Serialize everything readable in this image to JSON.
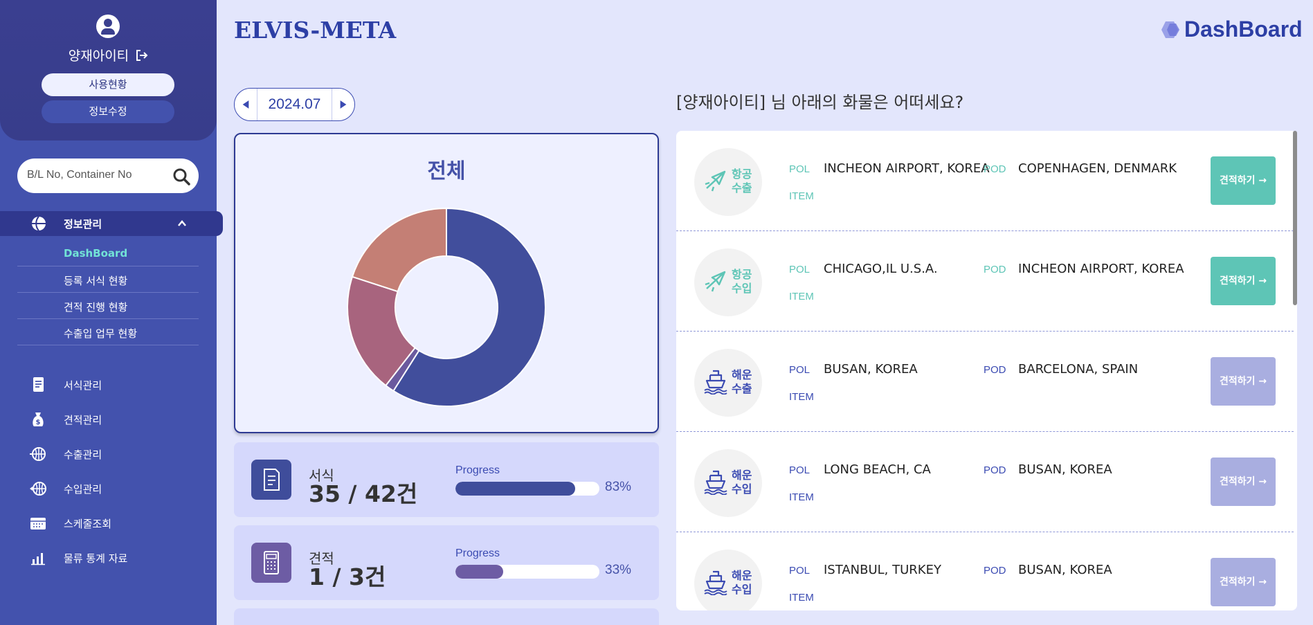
{
  "sidebar": {
    "user_name": "양재아이티",
    "usage_label": "사용현황",
    "edit_label": "정보수정",
    "search_placeholder": "B/L No, Container No",
    "open_menu": {
      "label": "정보관리",
      "icon": "globe-icon"
    },
    "submenu": [
      {
        "label": "DashBoard",
        "active": true
      },
      {
        "label": "등록 서식 현황"
      },
      {
        "label": "견적 진행 현황"
      },
      {
        "label": "수출입 업무 현황"
      }
    ],
    "menu": [
      {
        "label": "서식관리",
        "icon": "document-icon"
      },
      {
        "label": "견적관리",
        "icon": "money-bag-icon"
      },
      {
        "label": "수출관리",
        "icon": "globe-export-icon"
      },
      {
        "label": "수입관리",
        "icon": "globe-import-icon"
      },
      {
        "label": "스케줄조회",
        "icon": "calendar-icon"
      },
      {
        "label": "물류 통계 자료",
        "icon": "bar-chart-icon"
      }
    ]
  },
  "header": {
    "brand": "ELVIS-META",
    "page_title": "DashBoard"
  },
  "month": "2024.07",
  "summary": {
    "title": "전체",
    "chart_data": {
      "type": "pie",
      "slices": [
        {
          "value": 59,
          "color": "#414e9c"
        },
        {
          "value": 1.5,
          "color": "#6a5a9e"
        },
        {
          "value": 19.5,
          "color": "#a8647e"
        },
        {
          "value": 20,
          "color": "#c47f75"
        }
      ]
    }
  },
  "stats": [
    {
      "name": "서식",
      "count": "35 / 42건",
      "progress_label": "Progress",
      "percent_text": "83%",
      "fraction": 0.83,
      "color": "#3f4d9b"
    },
    {
      "name": "견적",
      "count": "1 / 3건",
      "progress_label": "Progress",
      "percent_text": "33%",
      "fraction": 0.33,
      "color": "#6d5ca4"
    }
  ],
  "greeting": "[양재아이티] 님 아래의 화물은 어떠세요?",
  "cargo": [
    {
      "mode": "air",
      "label1": "항공",
      "label2": "수출",
      "pol_key": "POL",
      "pol": "INCHEON AIRPORT, KOREA",
      "pod_key": "POD",
      "pod": "COPENHAGEN, DENMARK",
      "item_key": "ITEM",
      "button": "견적하기 →",
      "accent": "#5ec5b6",
      "active": true
    },
    {
      "mode": "air",
      "label1": "항공",
      "label2": "수입",
      "pol_key": "POL",
      "pol": "CHICAGO,IL U.S.A.",
      "pod_key": "POD",
      "pod": "INCHEON AIRPORT, KOREA",
      "item_key": "ITEM",
      "button": "견적하기 →",
      "accent": "#5ec5b6",
      "active": true
    },
    {
      "mode": "sea",
      "label1": "해운",
      "label2": "수출",
      "pol_key": "POL",
      "pol": "BUSAN, KOREA",
      "pod_key": "POD",
      "pod": "BARCELONA, SPAIN",
      "item_key": "ITEM",
      "button": "견적하기 →",
      "accent": "#3b4bb2",
      "active": false
    },
    {
      "mode": "sea",
      "label1": "해운",
      "label2": "수입",
      "pol_key": "POL",
      "pol": "LONG BEACH, CA",
      "pod_key": "POD",
      "pod": "BUSAN, KOREA",
      "item_key": "ITEM",
      "button": "견적하기 →",
      "accent": "#3b4bb2",
      "active": false
    },
    {
      "mode": "sea",
      "label1": "해운",
      "label2": "수입",
      "pol_key": "POL",
      "pol": "ISTANBUL, TURKEY",
      "pod_key": "POD",
      "pod": "BUSAN, KOREA",
      "item_key": "ITEM",
      "button": "견적하기 →",
      "accent": "#3b4bb2",
      "active": false
    }
  ],
  "colors": {
    "sidebar": "#4352ad",
    "brand": "#2d3fa5",
    "teal": "#5ec5b6",
    "lavender_button": "#a9aee0"
  }
}
